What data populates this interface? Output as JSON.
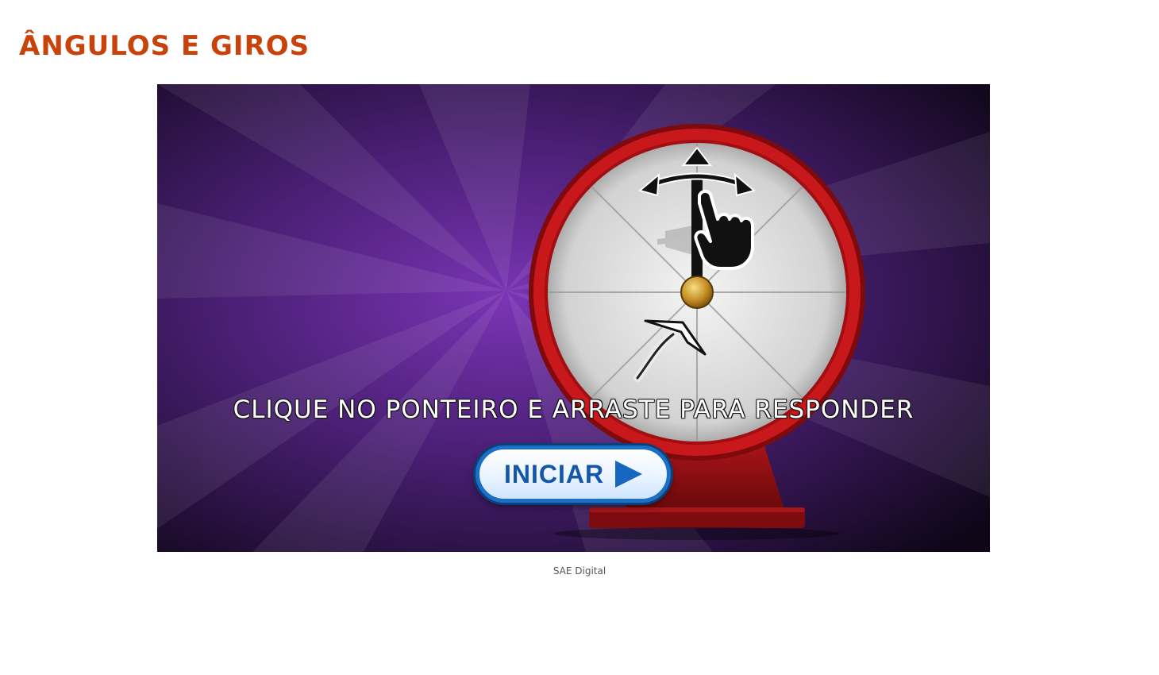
{
  "page": {
    "title": "ÂNGULOS E GIROS",
    "caption": "SAE Digital"
  },
  "game": {
    "instruction": "CLIQUE NO PONTEIRO E ARRASTE PARA RESPONDER",
    "start_button_label": "INICIAR",
    "icons": [
      "hand-pointer-icon",
      "drag-arrows-icon",
      "curved-arrow-icon",
      "play-icon"
    ]
  },
  "colors": {
    "title": "#c8420c",
    "background_purple": "#6b2a9e",
    "dial_rim": "#c8181b",
    "button_border": "#1b6fc4",
    "button_text": "#1457a8"
  }
}
